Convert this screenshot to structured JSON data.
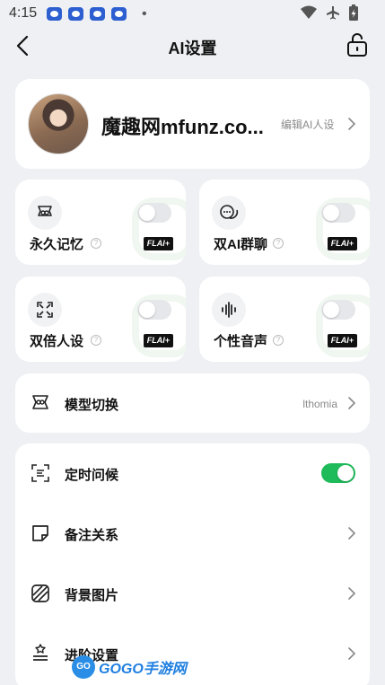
{
  "status_bar": {
    "time": "4:15"
  },
  "header": {
    "title": "AI设置"
  },
  "profile": {
    "name": "魔趣网mfunz.co...",
    "edit_label": "编辑AI人设"
  },
  "features": [
    {
      "label": "永久记忆",
      "badge": "FLAI+",
      "enabled": false,
      "icon": "memory-icon"
    },
    {
      "label": "双AI群聊",
      "badge": "FLAI+",
      "enabled": false,
      "icon": "group-chat-icon"
    },
    {
      "label": "双倍人设",
      "badge": "FLAI+",
      "enabled": false,
      "icon": "expand-icon"
    },
    {
      "label": "个性音声",
      "badge": "FLAI+",
      "enabled": false,
      "icon": "voice-wave-icon"
    }
  ],
  "model_row": {
    "label": "模型切换",
    "value": "lthomia"
  },
  "settings_rows": [
    {
      "label": "定时问候",
      "type": "toggle",
      "enabled": true
    },
    {
      "label": "备注关系",
      "type": "link"
    },
    {
      "label": "背景图片",
      "type": "link"
    },
    {
      "label": "进阶设置",
      "type": "link"
    }
  ],
  "watermark": {
    "logo": "GO",
    "text": "GOGO手游网"
  },
  "colors": {
    "toggle_on": "#1fba5a",
    "background": "#eef0f3",
    "badge": "#111111"
  }
}
